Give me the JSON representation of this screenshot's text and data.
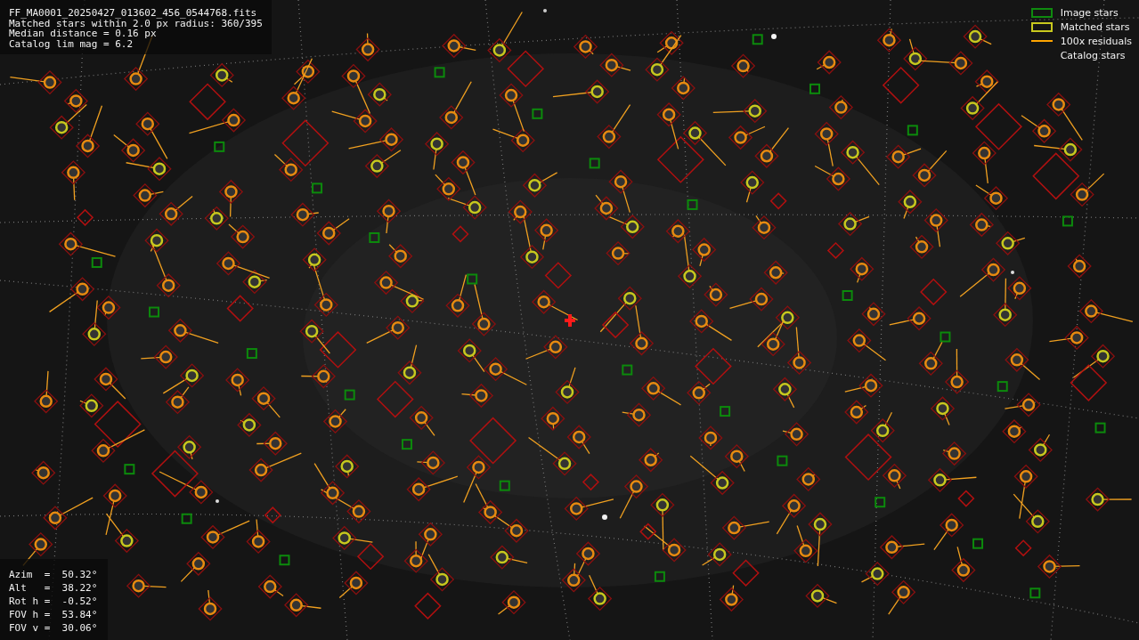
{
  "info_lines": [
    "FF_MA0001_20250427_013602_456_0544768.fits",
    "Matched stars within 2.0 px radius: 360/395",
    "Median distance = 0.16 px",
    "Catalog lim mag = 6.2"
  ],
  "legend": [
    {
      "label": "Image stars",
      "kind": "box",
      "color": "#0f8a0f"
    },
    {
      "label": "Matched stars",
      "kind": "box",
      "color": "#c8c81e"
    },
    {
      "label": "100x residuals",
      "kind": "line",
      "color": "#ffa500"
    },
    {
      "label": "Catalog stars",
      "kind": "blank"
    }
  ],
  "pointing_lines": [
    "Azim  =  50.32°",
    "Alt   =  38.22°",
    "Rot h =  -0.52°",
    "FOV h =  53.84°",
    "FOV v =  30.06°"
  ]
}
